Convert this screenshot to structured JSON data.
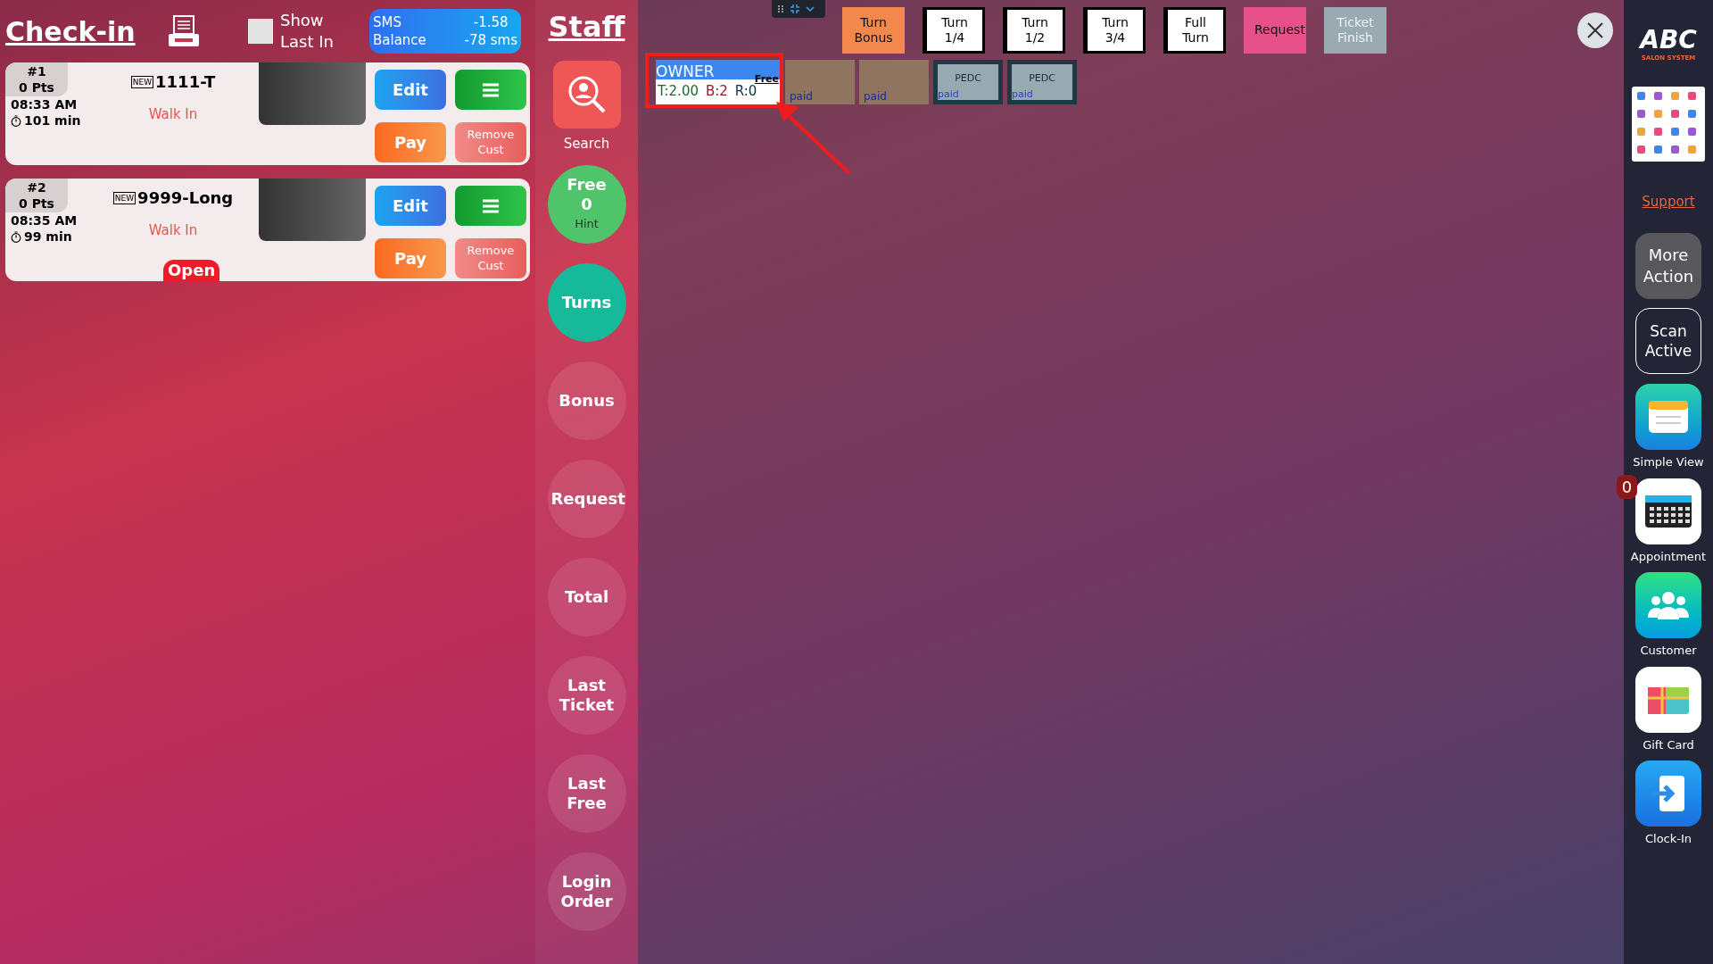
{
  "checkin": {
    "title": "Check-in",
    "show_last_in": {
      "label": "Show Last In",
      "checked": false
    },
    "sms": {
      "label": [
        "SMS",
        "Balance"
      ],
      "values": [
        "-1.58",
        "-78 sms"
      ]
    }
  },
  "tickets": [
    {
      "number": "#1",
      "points": "0 Pts",
      "time": "08:33 AM",
      "duration": "101 min",
      "badge": "NEW",
      "name": "1111-T",
      "type": "Walk In",
      "buttons": [
        "Edit",
        "Pay",
        "Remove Cust"
      ]
    },
    {
      "number": "#2",
      "points": "0 Pts",
      "time": "08:35 AM",
      "duration": "99 min",
      "badge": "NEW",
      "name": "9999-Long",
      "type": "Walk In",
      "status": "Open",
      "buttons": [
        "Edit",
        "Pay",
        "Remove Cust"
      ]
    }
  ],
  "staff": {
    "title": "Staff",
    "search": "Search",
    "nav": [
      {
        "kind": "counter",
        "label": "Free",
        "count": "0",
        "hint": "Hint",
        "selected": false
      },
      {
        "kind": "nav",
        "label": "Turns",
        "selected": true
      },
      {
        "kind": "nav",
        "label": "Bonus",
        "selected": false
      },
      {
        "kind": "nav",
        "label": "Request",
        "selected": false
      },
      {
        "kind": "nav",
        "label": "Total",
        "selected": false
      },
      {
        "kind": "nav",
        "label": "Last Ticket",
        "selected": false
      },
      {
        "kind": "nav",
        "label": "Last Free",
        "selected": false
      },
      {
        "kind": "nav",
        "label": "Login Order",
        "selected": false
      }
    ]
  },
  "toolbar": [
    {
      "label": "Turn Bonus",
      "color": "#f2884b"
    },
    {
      "label": "Turn 1/4",
      "color": "#ffffff"
    },
    {
      "label": "Turn 1/2",
      "color": "#ffffff"
    },
    {
      "label": "Turn 3/4",
      "color": "#ffffff"
    },
    {
      "label": "Full Turn",
      "color": "#ffffff"
    },
    {
      "label": "Request",
      "color": "#e8508a"
    },
    {
      "label": "Ticket Finish",
      "color": "#9aaab3"
    }
  ],
  "staff_cards": [
    {
      "kind": "active",
      "name": "OWNER",
      "status": "Free",
      "stats": [
        "T:2.00",
        "B:2",
        "R:0"
      ]
    },
    {
      "kind": "ticket",
      "paid": "paid"
    },
    {
      "kind": "ticket",
      "paid": "paid"
    },
    {
      "kind": "service",
      "code": "PEDC",
      "paid": "paid"
    },
    {
      "kind": "service",
      "code": "PEDC",
      "paid": "paid"
    }
  ],
  "sidebar": {
    "logo": "ABC",
    "logo_sub": "SALON SYSTEM",
    "support": "Support",
    "actions": [
      "More Action",
      "Scan Active"
    ],
    "apps": [
      {
        "kind": "simple",
        "label": "Simple View"
      },
      {
        "kind": "calendar",
        "label": "Appointment",
        "badge": "0"
      },
      {
        "kind": "customer",
        "label": "Customer"
      },
      {
        "kind": "gift",
        "label": "Gift Card"
      },
      {
        "kind": "clock",
        "label": "Clock-In"
      }
    ]
  }
}
